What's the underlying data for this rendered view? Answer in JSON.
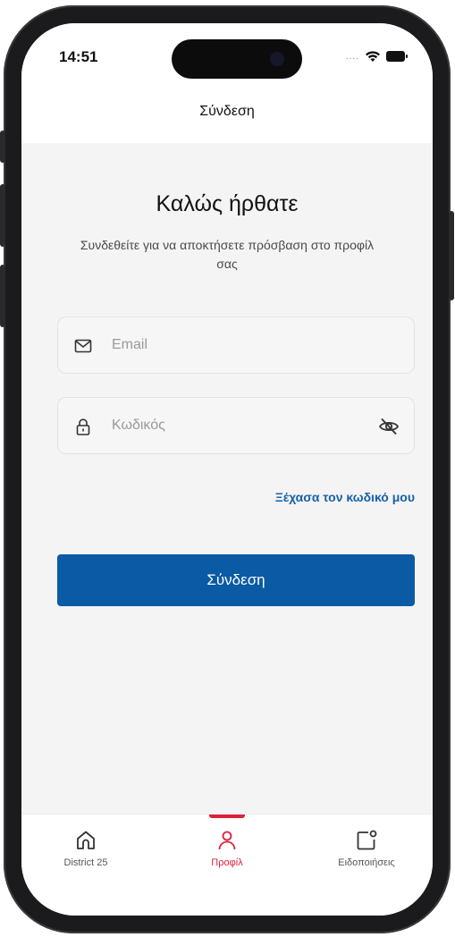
{
  "status_bar": {
    "time": "14:51",
    "signal_dots": "....",
    "wifi_icon": "wifi-icon",
    "battery_icon": "battery-icon"
  },
  "header": {
    "title": "Σύνδεση"
  },
  "login": {
    "welcome": "Καλώς ήρθατε",
    "subtitle": "Συνδεθείτε για να αποκτήσετε πρόσβαση στο προφίλ σας",
    "email": {
      "value": "",
      "placeholder": "Email",
      "icon": "mail-icon"
    },
    "password": {
      "value": "",
      "placeholder": "Κωδικός",
      "icon": "lock-icon",
      "toggle_icon": "eye-off-icon"
    },
    "forgot_link": "Ξέχασα τον κωδικό μου",
    "submit_label": "Σύνδεση"
  },
  "tabbar": {
    "items": [
      {
        "label": "District 25",
        "icon": "home-icon",
        "active": false
      },
      {
        "label": "Προφίλ",
        "icon": "person-icon",
        "active": true
      },
      {
        "label": "Ειδοποιήσεις",
        "icon": "notification-icon",
        "active": false
      }
    ]
  },
  "colors": {
    "primary": "#0b5aa5",
    "link": "#1661a8",
    "active_tab": "#e0203a",
    "background": "#f4f4f5"
  }
}
